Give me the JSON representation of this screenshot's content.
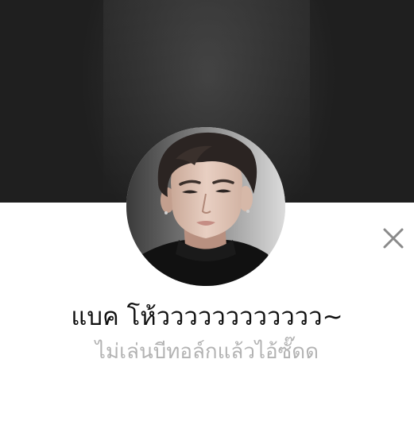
{
  "profile": {
    "name": "แบค โห้วววววววววววว~",
    "status_message": "ไม่เล่นบีทอล์กแล้วไอ้ซั๊ดด"
  },
  "icons": {
    "close": "close-icon"
  },
  "colors": {
    "cover_background": "#2a2a2a",
    "name_text": "#111111",
    "status_text": "#b3b3b3",
    "close_icon": "#8a8a8a"
  }
}
